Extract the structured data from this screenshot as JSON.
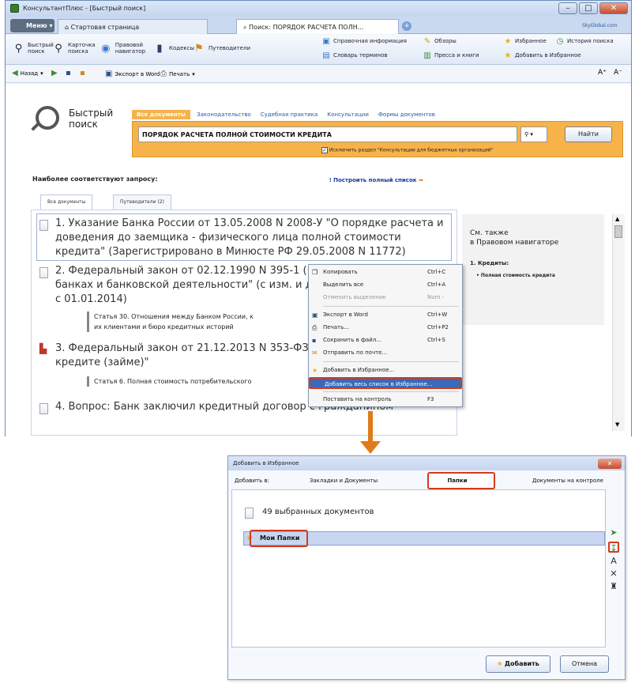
{
  "window": {
    "title": "КонсультантПлюс - [Быстрый поиск]"
  },
  "tabs": {
    "menu_label": "Меню",
    "start_tab": "Стартовая страница",
    "search_tab": "Поиск: ПОРЯДОК РАСЧЕТА ПОЛН...",
    "right_link": "SkyGlobal.com"
  },
  "toolbar1": {
    "quick_search": "Быстрый поиск",
    "card_search": "Карточка поиска",
    "legal_nav": "Правовой навигатор",
    "codes": "Кодексы",
    "guides": "Путеводители",
    "reference": "Справочная информация",
    "reviews": "Обзоры",
    "dictionary": "Словарь терминов",
    "press": "Пресса и книги",
    "favorites": "Избранное",
    "history": "История поиска",
    "add_favorites": "Добавить в Избранное"
  },
  "toolbar2": {
    "back": "Назад",
    "export_word": "Экспорт в Word",
    "print": "Печать",
    "zoom_in": "A⁺",
    "zoom_out": "A⁻"
  },
  "search": {
    "title_line1": "Быстрый",
    "title_line2": "поиск",
    "tabs": [
      "Все документы",
      "Законодательство",
      "Судебная практика",
      "Консультации",
      "Формы документов"
    ],
    "query": "ПОРЯДОК РАСЧЕТА ПОЛНОЙ СТОИМОСТИ КРЕДИТА",
    "find_button": "Найти",
    "exclude_label": "Исключить раздел \"Консультации для бюджетных организаций\""
  },
  "results": {
    "heading": "Наиболее соответствуют запросу:",
    "full_list_link": "Построить полный список",
    "tab_all": "Все документы",
    "tab_guides": "Путеводители (2)",
    "doc1": "1. Указание Банка России от 13.05.2008 N 2008-У \"О порядке расчета и доведения до заемщика - физического лица полной стоимости кредита\" (Зарегистрировано в Минюсте РФ 29.05.2008 N 11772)",
    "doc2_l1": "2. Федеральный закон от 02.12.1990 N 395-1 (",
    "doc2_l2": "банках и банковской деятельности\" (с изм. и д",
    "doc2_l3": "с 01.01.2014)",
    "doc2_sub_l1": "Статья 30. Отношения между Банком России, к",
    "doc2_sub_l2": "их клиентами и бюро кредитных историй",
    "doc3_l1": "3. Федеральный закон от 21.12.2013 N 353-ФЗ",
    "doc3_l2": "кредите (займе)\"",
    "doc3_sub": "Статья 6. Полная стоимость потребительского",
    "doc4": "4. Вопрос: Банк заключил кредитный договор с гражданином"
  },
  "sidebar": {
    "see_also": "См. также",
    "in_navigator": "в Правовом навигаторе",
    "item": "1. Кредиты:",
    "subitem": "• Полная стоимость кредита"
  },
  "context_menu": {
    "items": [
      {
        "label": "Копировать",
        "shortcut": "Ctrl+C"
      },
      {
        "label": "Выделить все",
        "shortcut": "Ctrl+A"
      },
      {
        "label": "Отменить выделение",
        "shortcut": "Num -"
      },
      {
        "label": "Экспорт в Word",
        "shortcut": "Ctrl+W"
      },
      {
        "label": "Печать...",
        "shortcut": "Ctrl+P2"
      },
      {
        "label": "Сохранить в файл...",
        "shortcut": "Ctrl+S"
      },
      {
        "label": "Отправить по почте..."
      },
      {
        "label": "Добавить в Избранное..."
      },
      {
        "label": "Добавить весь список в Избранное..."
      },
      {
        "label": "Поставить на контроль",
        "shortcut": "F3"
      }
    ]
  },
  "dialog": {
    "title": "Добавить в Избранное",
    "add_to": "Добавить в:",
    "tab_bookmarks": "Закладки и Документы",
    "tab_folders": "Папки",
    "tab_control": "Документы на контроле",
    "selected_docs": "49 выбранных документов",
    "folder": "Мои Папки",
    "add_button": "Добавить",
    "cancel_button": "Отмена"
  },
  "colors": {
    "accent_orange": "#f7b24a",
    "highlight_red": "#d63a1c",
    "menu_blue": "#3a69b8"
  }
}
